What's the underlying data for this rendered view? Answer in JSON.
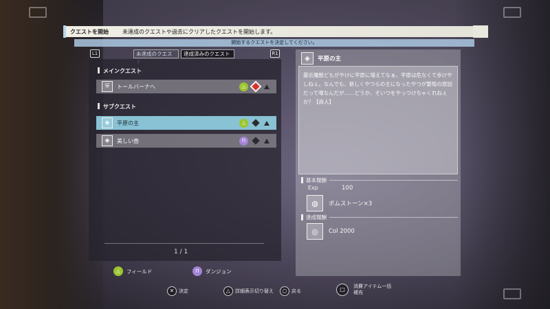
{
  "header": {
    "title": "クエストを開始",
    "description": "未達成のクエストや過去にクリアしたクエストを開始します。",
    "instruction": "開始するクエストを決定してください。"
  },
  "tabs": {
    "left_trigger": "L1",
    "right_trigger": "R1",
    "items": [
      {
        "label": "未達成のクエスト",
        "active": true
      },
      {
        "label": "達成済みのクエスト",
        "active": false
      }
    ]
  },
  "quest_list": {
    "main_section": "メインクエスト",
    "sub_section": "サブクエスト",
    "main_quests": [
      {
        "label": "トールバーナへ",
        "type": "field",
        "selected": false
      }
    ],
    "sub_quests": [
      {
        "label": "平原の主",
        "type": "field",
        "selected": true
      },
      {
        "label": "美しい壺",
        "type": "dungeon",
        "selected": false
      }
    ],
    "page": "1 / 1"
  },
  "detail": {
    "title": "平原の主",
    "description": "最近魔獣どもがやけに平原に増えてなぁ、平原は危なくて歩けやしねぇ。なんでも、新しくやつらの主になったやつが繁殖の原因だって噂なんだが……どうか、そいつをやっつけちゃくれねぇか？【商人】",
    "basic_reward_label": "基本報酬",
    "exp_label": "Exp",
    "exp_value": "100",
    "basic_item": "ボムストーン×3",
    "achievement_reward_label": "達成報酬",
    "col_reward": "Col 2000"
  },
  "legend": {
    "field": "フィールド",
    "dungeon": "ダンジョン"
  },
  "controls": {
    "confirm": "決定",
    "toggle_detail": "詳細表示切り替え",
    "back": "戻る",
    "consumable_1": "消費アイテム一括",
    "consumable_2": "補充"
  },
  "colors": {
    "selected_row": "#88c2d4",
    "field_badge": "#9cc52e",
    "dungeon_badge": "#a385d6",
    "subbar": "#aac8e1"
  }
}
